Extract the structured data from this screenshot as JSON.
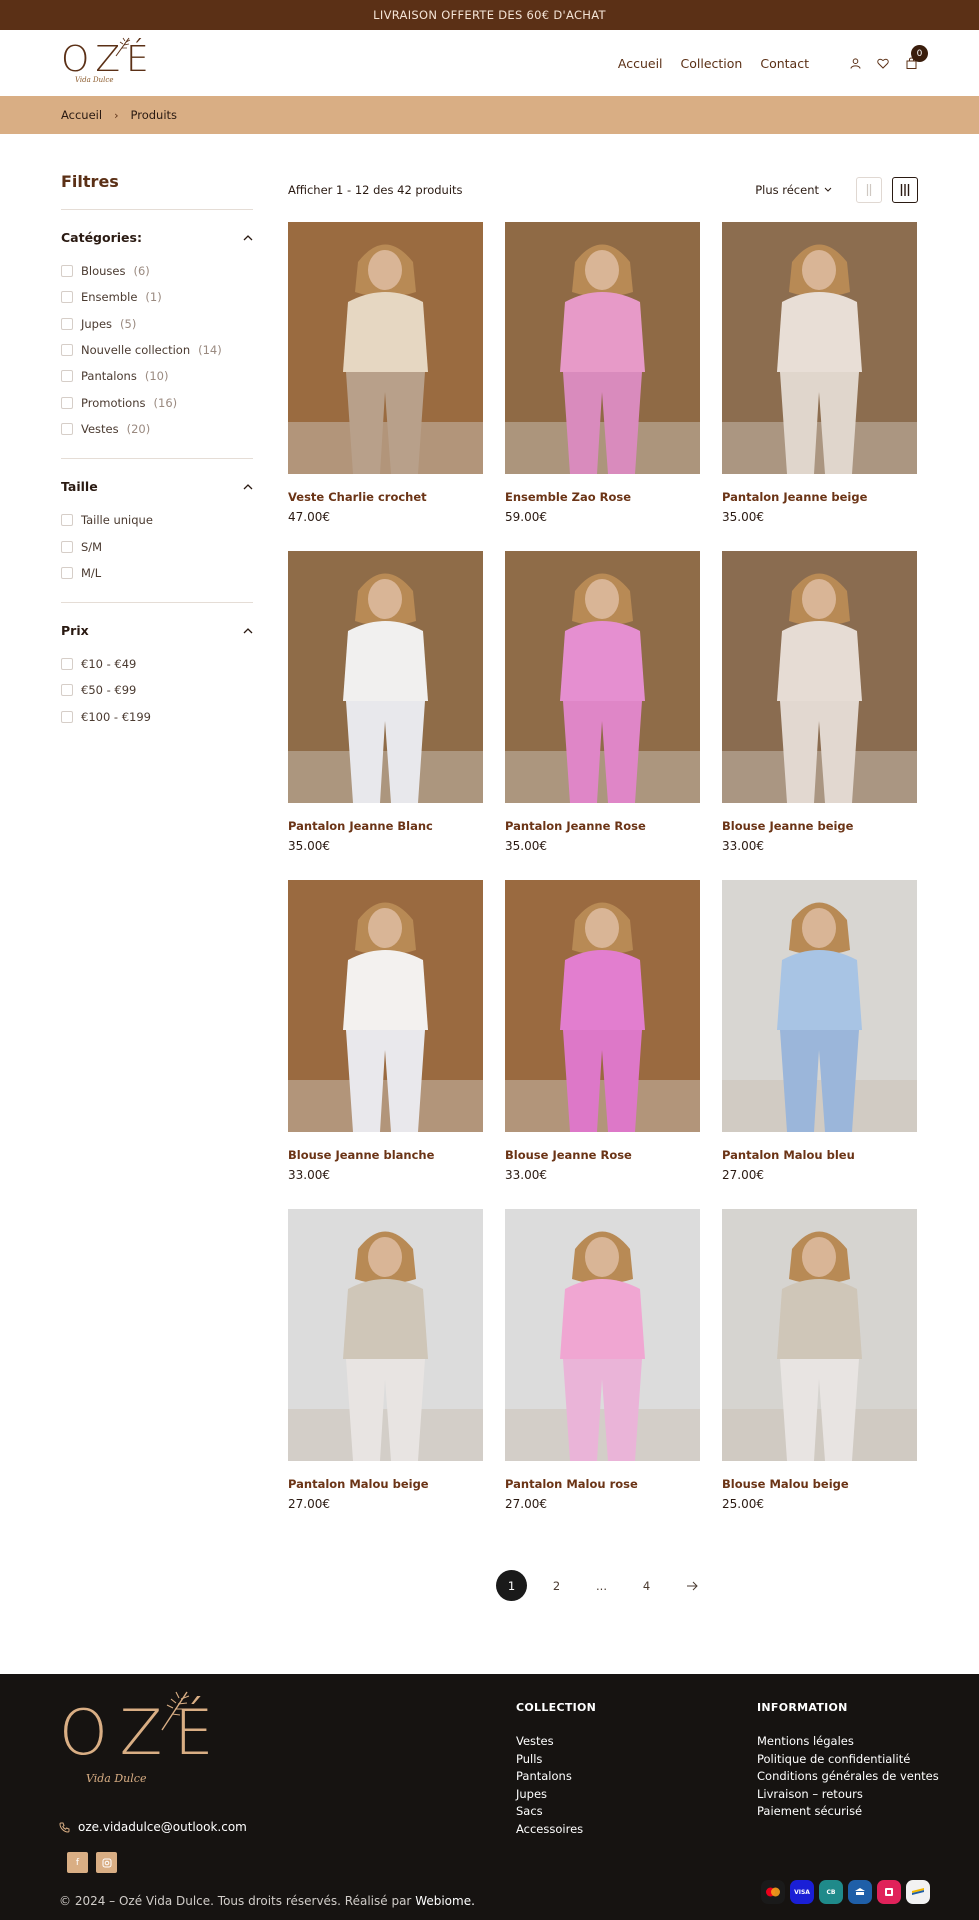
{
  "topbar": {
    "text": "LIVRAISON OFFERTE DES 60€ D'ACHAT"
  },
  "header": {
    "logo_text": "OZÉ",
    "logo_sub": "Vida Dulce",
    "nav": [
      "Accueil",
      "Collection",
      "Contact"
    ],
    "cart_count": "0",
    "icons": [
      "user-icon",
      "heart-icon",
      "bag-icon"
    ]
  },
  "breadcrumb": {
    "items": [
      "Accueil",
      "Produits"
    ]
  },
  "filters": {
    "title": "Filtres",
    "sections": [
      {
        "title": "Catégories:",
        "options": [
          {
            "label": "Blouses",
            "count": "(6)"
          },
          {
            "label": "Ensemble",
            "count": "(1)"
          },
          {
            "label": "Jupes",
            "count": "(5)"
          },
          {
            "label": "Nouvelle collection",
            "count": "(14)"
          },
          {
            "label": "Pantalons",
            "count": "(10)"
          },
          {
            "label": "Promotions",
            "count": "(16)"
          },
          {
            "label": "Vestes",
            "count": "(20)"
          }
        ]
      },
      {
        "title": "Taille",
        "options": [
          {
            "label": "Taille unique",
            "count": ""
          },
          {
            "label": "S/M",
            "count": ""
          },
          {
            "label": "M/L",
            "count": ""
          }
        ]
      },
      {
        "title": "Prix",
        "options": [
          {
            "label": "€10 - €49",
            "count": ""
          },
          {
            "label": "€50 - €99",
            "count": ""
          },
          {
            "label": "€100 - €199",
            "count": ""
          }
        ]
      }
    ]
  },
  "toolbar": {
    "count_text": "Afficher 1 - 12 des 42 produits",
    "sort_label": "Plus récent"
  },
  "products": [
    {
      "name": "Veste Charlie crochet",
      "price": "47.00€",
      "top": "#e6d7c2",
      "bottom": "#b8a08a",
      "bg": "#9a6b40"
    },
    {
      "name": "Ensemble Zao Rose",
      "price": "59.00€",
      "top": "#e79ac8",
      "bottom": "#d98bbd",
      "bg": "#8f6a45"
    },
    {
      "name": "Pantalon Jeanne beige",
      "price": "35.00€",
      "top": "#e8ded6",
      "bottom": "#e0d6cc",
      "bg": "#8c6d4f"
    },
    {
      "name": "Pantalon Jeanne Blanc",
      "price": "35.00€",
      "top": "#f1f0ef",
      "bottom": "#e8e8ec",
      "bg": "#8f6c48"
    },
    {
      "name": "Pantalon Jeanne Rose",
      "price": "35.00€",
      "top": "#e58fd0",
      "bottom": "#df86c7",
      "bg": "#8f6c48"
    },
    {
      "name": "Blouse Jeanne beige",
      "price": "33.00€",
      "top": "#e6dcd4",
      "bottom": "#e2d8d0",
      "bg": "#8a6c50"
    },
    {
      "name": "Blouse Jeanne blanche",
      "price": "33.00€",
      "top": "#f3f1ef",
      "bottom": "#e9e8ec",
      "bg": "#9a6a40"
    },
    {
      "name": "Blouse Jeanne Rose",
      "price": "33.00€",
      "top": "#e27ecf",
      "bottom": "#dd78c8",
      "bg": "#9a6a40"
    },
    {
      "name": "Pantalon Malou bleu",
      "price": "27.00€",
      "top": "#a8c4e4",
      "bottom": "#9bb6da",
      "bg": "#d8d6d2"
    },
    {
      "name": "Pantalon Malou beige",
      "price": "27.00€",
      "top": "#cfc6b8",
      "bottom": "#e8e4e2",
      "bg": "#dcdcdc"
    },
    {
      "name": "Pantalon Malou rose",
      "price": "27.00€",
      "top": "#f0a6d2",
      "bottom": "#eab4d8",
      "bg": "#dcdcdc"
    },
    {
      "name": "Blouse Malou beige",
      "price": "25.00€",
      "top": "#cfc6b8",
      "bottom": "#e8e4e2",
      "bg": "#d6d4d0"
    }
  ],
  "pagination": {
    "pages": [
      "1",
      "2",
      "...",
      "4"
    ],
    "active": "1"
  },
  "footer": {
    "email": "oze.vidadulce@outlook.com",
    "collection_title": "COLLECTION",
    "collection_links": [
      "Vestes",
      "Pulls",
      "Pantalons",
      "Jupes",
      "Sacs",
      "Accessoires"
    ],
    "info_title": "INFORMATION",
    "info_links": [
      "Mentions légales",
      "Politique de confidentialité",
      "Conditions générales de ventes",
      "Livraison – retours",
      "Paiement sécurisé"
    ],
    "copyright": "© 2024 – Ozé Vida Dulce. Tous droits réservés. Réalisé par ",
    "copyright_brand": "Webiome.",
    "payments": [
      {
        "name": "mastercard-icon",
        "color": "#1a1a1a"
      },
      {
        "name": "visa-icon",
        "color": "#1a1fd6"
      },
      {
        "name": "carte-bancaire-icon",
        "color": "#1f8a8a"
      },
      {
        "name": "bank-icon",
        "color": "#1f5fa8"
      },
      {
        "name": "bancontact-icon",
        "color": "#e0225a"
      },
      {
        "name": "wallet-icon",
        "color": "#f2f2f2"
      }
    ]
  },
  "colors": {
    "brown": "#5b3016",
    "tan": "#d9ae84",
    "footer_bg": "#161311"
  }
}
